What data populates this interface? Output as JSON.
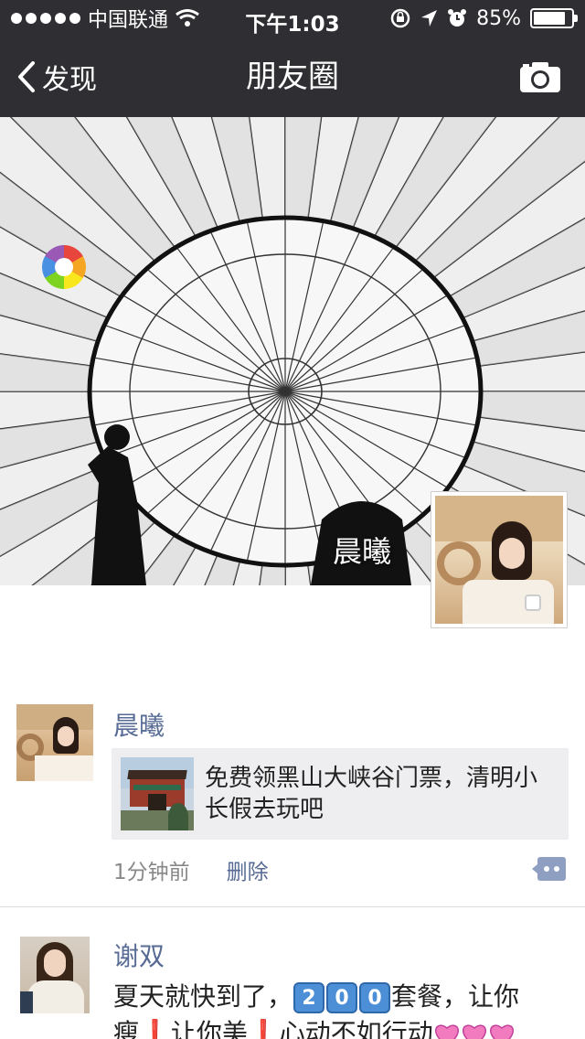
{
  "status_bar": {
    "carrier": "中国联通",
    "time": "下午1:03",
    "battery": "85%",
    "battery_level": 0.85
  },
  "nav": {
    "back_label": "发现",
    "title": "朋友圈"
  },
  "cover": {
    "owner_name": "晨曦"
  },
  "posts": [
    {
      "name": "晨曦",
      "share_text": "免费领黑山大峡谷门票，清明小长假去玩吧",
      "time": "1分钟前",
      "delete_label": "删除"
    },
    {
      "name": "谢双",
      "text_part1": "夏天就快到了，",
      "nums": [
        "2",
        "0",
        "0"
      ],
      "text_part2": "套餐，让你",
      "line2_a": "瘦",
      "line2_b": "让你美",
      "line2_c": "心动不如行动"
    }
  ],
  "colors": {
    "bar": "#2e2e33",
    "link": "#576b95"
  },
  "icons": [
    "back-chevron-icon",
    "camera-icon",
    "wifi-icon",
    "lock-rotation-icon",
    "location-arrow-icon",
    "alarm-icon",
    "battery-icon",
    "lens-logo-icon",
    "comment-icon",
    "heart-icon"
  ]
}
